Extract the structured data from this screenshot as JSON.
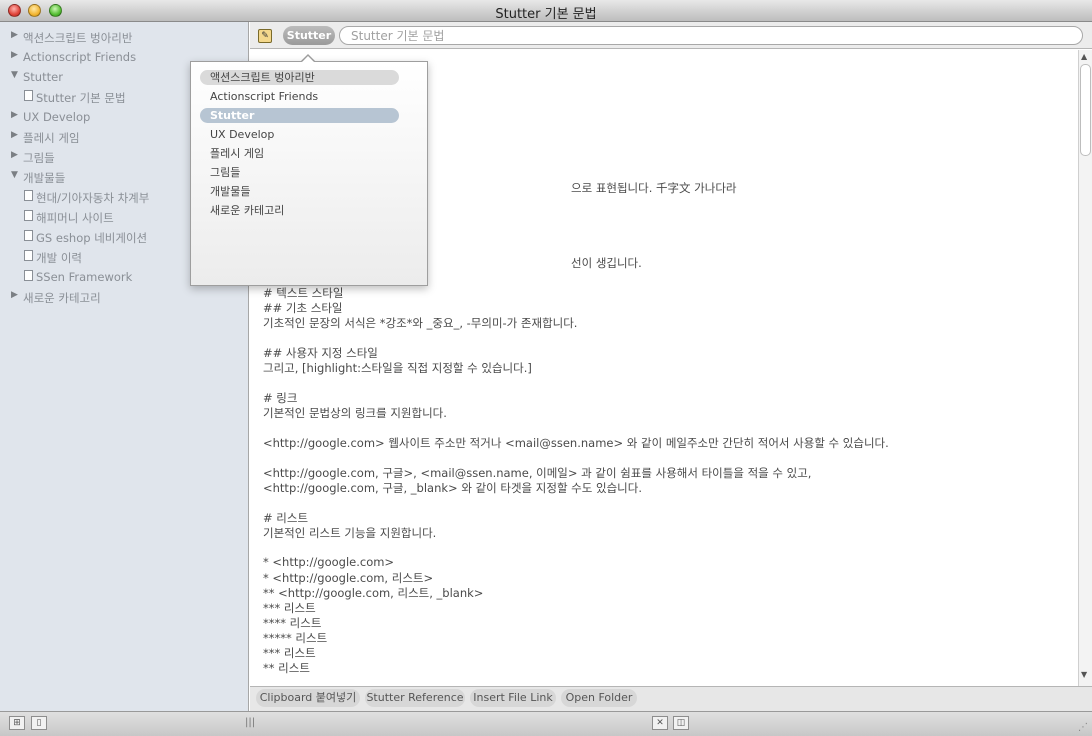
{
  "window": {
    "title": "Stutter 기본 문법"
  },
  "sidebar": {
    "items": [
      {
        "label": "액션스크립트 벙아리반",
        "type": "folder",
        "expanded": false
      },
      {
        "label": "Actionscript Friends",
        "type": "folder",
        "expanded": false
      },
      {
        "label": "Stutter",
        "type": "folder",
        "expanded": true
      },
      {
        "label": "Stutter 기본 문법",
        "type": "doc"
      },
      {
        "label": "UX Develop",
        "type": "folder",
        "expanded": false
      },
      {
        "label": "플레시 게임",
        "type": "folder",
        "expanded": false
      },
      {
        "label": "그림들",
        "type": "folder",
        "expanded": false
      },
      {
        "label": "개발물들",
        "type": "folder",
        "expanded": true
      },
      {
        "label": "현대/기아자동차 차계부",
        "type": "doc"
      },
      {
        "label": "해피머니 사이트",
        "type": "doc"
      },
      {
        "label": "GS eshop 네비게이션",
        "type": "doc"
      },
      {
        "label": "개발 이력",
        "type": "doc"
      },
      {
        "label": "SSen Framework",
        "type": "doc"
      },
      {
        "label": "새로운 카테고리",
        "type": "folder",
        "expanded": false
      }
    ]
  },
  "toolbar": {
    "category_button": "Stutter",
    "title_field_value": "Stutter 기본 문법"
  },
  "popup": {
    "items": [
      {
        "label": "액션스크립트 벙아리반",
        "state": "hover"
      },
      {
        "label": "Actionscript Friends",
        "state": ""
      },
      {
        "label": "Stutter",
        "state": "selected"
      },
      {
        "label": "UX Develop",
        "state": ""
      },
      {
        "label": "플레시 게임",
        "state": ""
      },
      {
        "label": "그림들",
        "state": ""
      },
      {
        "label": "개발물들",
        "state": ""
      },
      {
        "label": "새로운 카테고리",
        "state": ""
      }
    ]
  },
  "editor": {
    "lines": [
      "으로 표현됩니다. 千字文 가나다라",
      "선이 생깁니다.",
      "# 텍스트 스타일",
      "## 기초 스타일",
      "기초적인 문장의 서식은 *강조*와 _중요_, -무의미-가 존재합니다.",
      "## 사용자 지정 스타일",
      "그리고, [highlight:스타일을 직접 지정할 수 있습니다.]",
      "# 링크",
      "기본적인 문법상의 링크를 지원합니다.",
      "<http://google.com> 웹사이트 주소만 적거나 <mail@ssen.name> 와 같이 메일주소만 간단히 적어서 사용할 수 있습니다.",
      "<http://google.com, 구글>, <mail@ssen.name, 이메일> 과 같이 쉼표를 사용해서 타이틀을 적을 수 있고,",
      "<http://google.com, 구글, _blank> 와 같이 타겟을 지정할 수도 있습니다.",
      "# 리스트",
      "기본적인 리스트 기능을 지원합니다.",
      "* <http://google.com>",
      "* <http://google.com, 리스트>",
      "** <http://google.com, 리스트, _blank>",
      "*** 리스트",
      "**** 리스트",
      "***** 리스트",
      "*** 리스트",
      "** 리스트"
    ]
  },
  "bottom_buttons": {
    "clipboard": "Clipboard 붙여넣기",
    "reference": "Stutter Reference",
    "insert_link": "Insert File Link",
    "open_folder": "Open Folder"
  },
  "icons": {
    "tree_collapsed": "▶",
    "tree_expanded": "▼",
    "scroll_up": "▲",
    "scroll_down": "▼"
  }
}
